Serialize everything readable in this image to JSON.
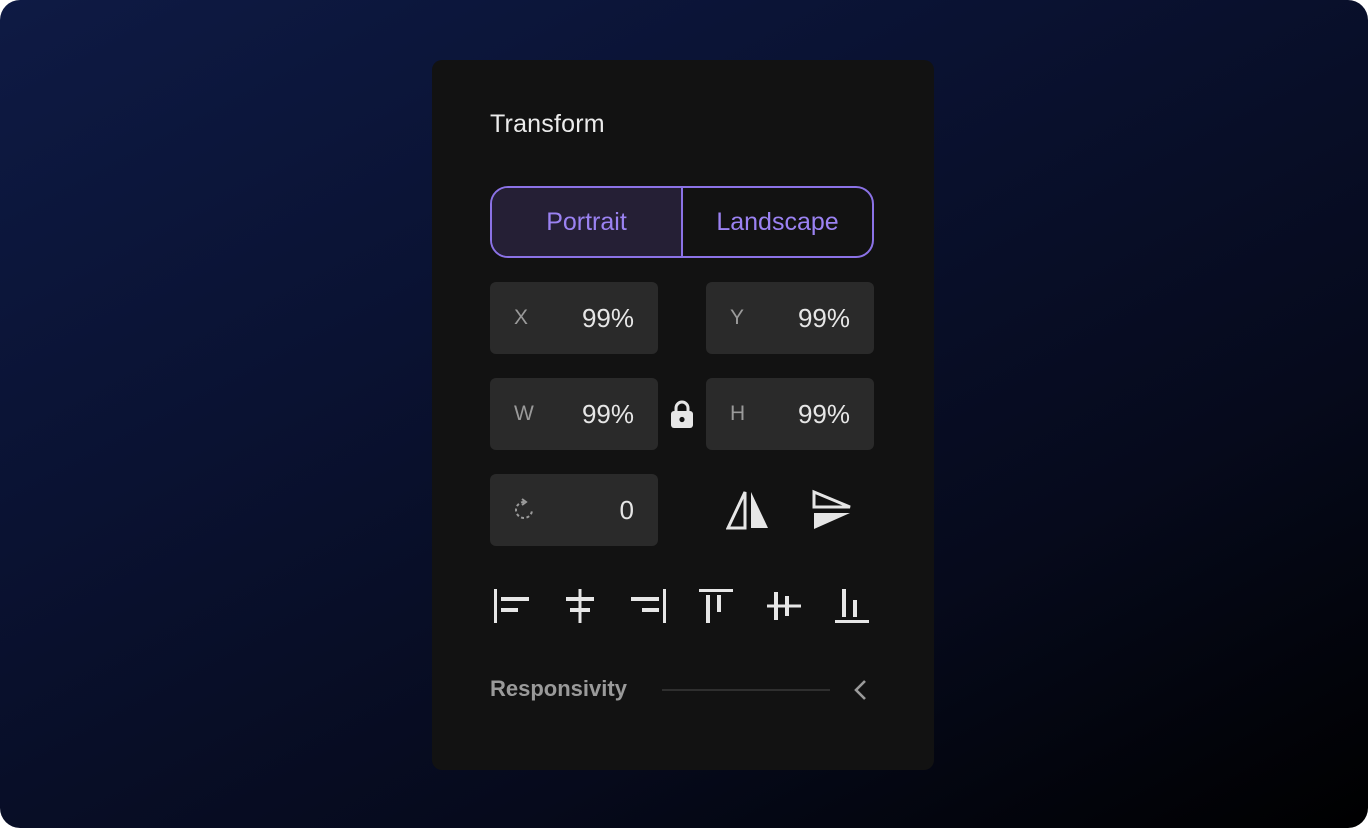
{
  "panel": {
    "title": "Transform"
  },
  "orientation": {
    "options": [
      "Portrait",
      "Landscape"
    ],
    "selected": "Portrait"
  },
  "fields": {
    "x": {
      "label": "X",
      "value": "99%"
    },
    "y": {
      "label": "Y",
      "value": "99%"
    },
    "w": {
      "label": "W",
      "value": "99%"
    },
    "h": {
      "label": "H",
      "value": "99%"
    },
    "rotation": {
      "icon": "rotate-icon",
      "value": "0"
    }
  },
  "icons": {
    "lock": "lock-icon",
    "flip_horizontal": "flip-horizontal-icon",
    "flip_vertical": "flip-vertical-icon",
    "align": [
      "align-left-icon",
      "align-center-horizontal-icon",
      "align-right-icon",
      "align-top-icon",
      "align-center-vertical-icon",
      "align-bottom-icon"
    ],
    "collapse": "chevron-left-icon"
  },
  "responsivity": {
    "label": "Responsivity"
  },
  "colors": {
    "accent": "#8b72e6",
    "panel": "#121212",
    "field": "#2a2a2a"
  }
}
